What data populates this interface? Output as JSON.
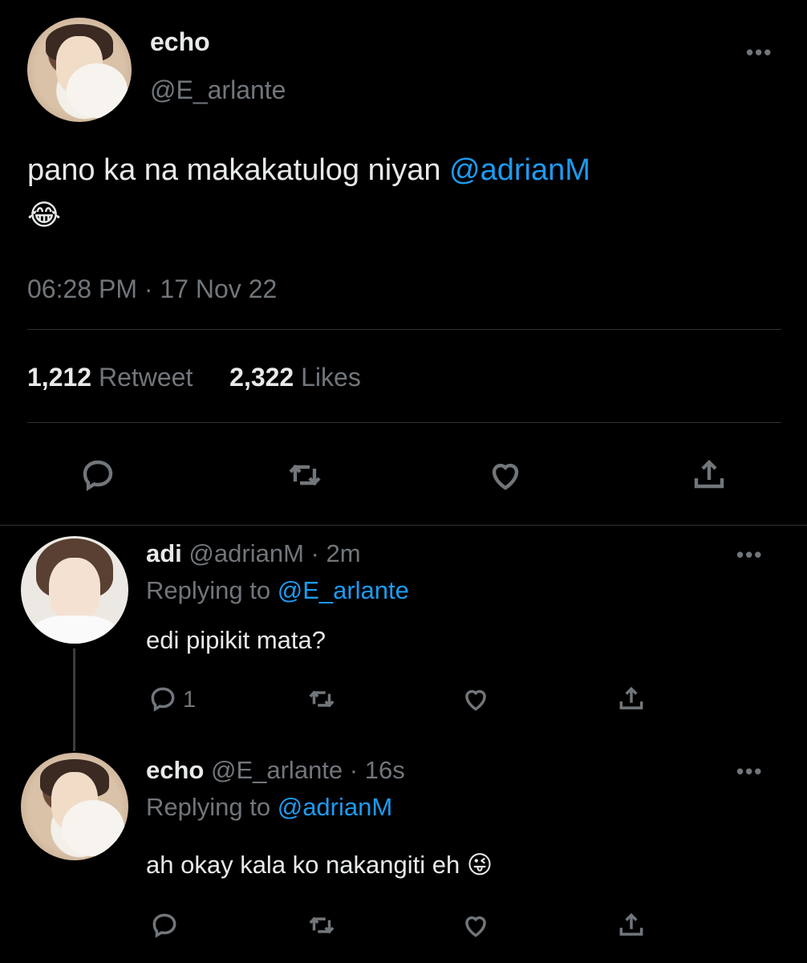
{
  "main_tweet": {
    "display_name": "echo",
    "handle": "@E_arlante",
    "text_before_mention": "pano ka na makakatulog niyan ",
    "mention": "@adrianM",
    "emoji": "😂",
    "timestamp": "06:28 PM · 17 Nov 22",
    "retweet_count": "1,212",
    "retweet_label": "Retweet",
    "like_count": "2,322",
    "like_label": "Likes",
    "more_label": "•••"
  },
  "reply1": {
    "display_name": "adi",
    "handle": "@adrianM",
    "time": "· 2m",
    "replying_prefix": "Replying to ",
    "replying_to": "@E_arlante",
    "text": "edi pipikit mata?",
    "reply_count": "1",
    "more_label": "•••"
  },
  "reply2": {
    "display_name": "echo",
    "handle": "@E_arlante",
    "time": "· 16s",
    "replying_prefix": "Replying to ",
    "replying_to": "@adrianM",
    "text": "ah okay kala ko nakangiti eh",
    "emoji": "😜",
    "more_label": "•••"
  },
  "colors": {
    "background": "#000000",
    "text": "#e7e9ea",
    "muted": "#71767b",
    "link": "#1d9bf0",
    "divider": "#2f3336"
  }
}
